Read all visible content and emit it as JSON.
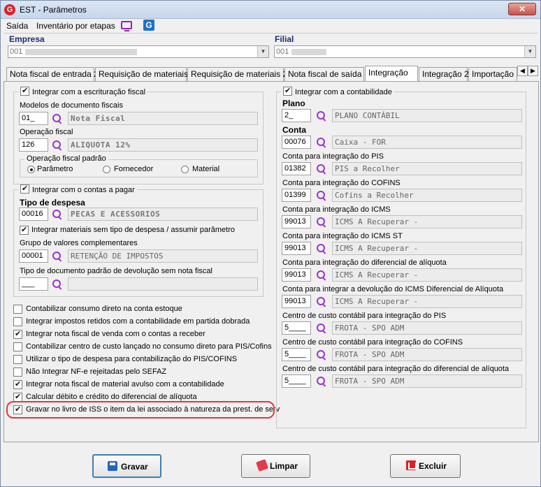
{
  "window": {
    "title": "EST - Parâmetros",
    "close": "✕"
  },
  "menu": {
    "items": [
      "Saída",
      "Inventário por etapas"
    ]
  },
  "empresa": {
    "label": "Empresa",
    "value": "001"
  },
  "filial": {
    "label": "Filial",
    "value": "001"
  },
  "tabs": [
    "Nota fiscal de entrada 2",
    "Requisição de materiais",
    "Requisição de materiais 2",
    "Nota fiscal de saída",
    "Integração",
    "Integração 2",
    "Importação X"
  ],
  "left": {
    "escrituracao": {
      "title": "Integrar com a escrituração fiscal",
      "modelos_label": "Modelos de documento fiscais",
      "modelos_code": "01_",
      "modelos_desc": "Nota Fiscal",
      "operacao_label": "Operação fiscal",
      "operacao_code": "126",
      "operacao_desc": "ALIQUOTA 12%",
      "padrao_title": "Operação fiscal padrão",
      "radio_parametro": "Parâmetro",
      "radio_fornecedor": "Fornecedor",
      "radio_material": "Material"
    },
    "pagar": {
      "title": "Integrar com o contas a pagar",
      "tipo_label": "Tipo de despesa",
      "tipo_code": "00016",
      "tipo_desc": "PECAS E ACESSORIOS",
      "materiais_label": "Integrar materiais sem tipo de despesa / assumir parâmetro",
      "grupo_label": "Grupo de valores complementares",
      "grupo_code": "00001",
      "grupo_desc": "RETENÇÃO DE IMPOSTOS",
      "devolucao_label": "Tipo de documento padrão de devolução sem nota fiscal",
      "devolucao_code": "___"
    },
    "options": [
      "Contabilizar consumo direto na conta estoque",
      "Integrar impostos retidos com a contabilidade em partida dobrada",
      "Integrar nota fiscal de venda com o contas a receber",
      "Contabilizar centro de custo lançado no consumo direto para PIS/Cofins",
      "Utilizar o tipo de despesa para contabilização do PIS/COFINS",
      "Não Integrar NF-e rejeitadas pelo SEFAZ",
      "Integrar nota fiscal de material avulso com a contabilidade",
      "Calcular débito e crédito do diferencial de alíquota",
      "Gravar no livro de ISS o item da lei associado à natureza da prest. de serv"
    ]
  },
  "right": {
    "title": "Integrar com a contabilidade",
    "fields": [
      {
        "label": "Plano",
        "code": "2_",
        "desc": "PLANO CONTÁBIL"
      },
      {
        "label": "Conta",
        "code": "00076",
        "desc": "Caixa - FOR"
      },
      {
        "label": "Conta para integração do PIS",
        "code": "01382",
        "desc": "PIS a Recolher"
      },
      {
        "label": "Conta para integração do COFINS",
        "code": "01399",
        "desc": "Cofins a Recolher"
      },
      {
        "label": "Conta para integração do ICMS",
        "code": "99013",
        "desc": "ICMS A Recuperar -"
      },
      {
        "label": "Conta para integração do ICMS ST",
        "code": "99013",
        "desc": "ICMS A Recuperar -"
      },
      {
        "label": "Conta para integração do diferencial de alíquota",
        "code": "99013",
        "desc": "ICMS A Recuperar -"
      },
      {
        "label": "Conta para integrar a devolução do ICMS Diferencial de Alíquota",
        "code": "99013",
        "desc": "ICMS A Recuperar -"
      },
      {
        "label": "Centro de custo contábil para integração do PIS",
        "code": "5____",
        "desc": "FROTA - SPO ADM"
      },
      {
        "label": "Centro de custo contábil para integração do COFINS",
        "code": "5____",
        "desc": "FROTA - SPO ADM"
      },
      {
        "label": "Centro de custo contábil para integração do diferencial de alíquota",
        "code": "5____",
        "desc": "FROTA - SPO ADM"
      }
    ]
  },
  "buttons": {
    "gravar": "Gravar",
    "limpar": "Limpar",
    "excluir": "Excluir"
  }
}
